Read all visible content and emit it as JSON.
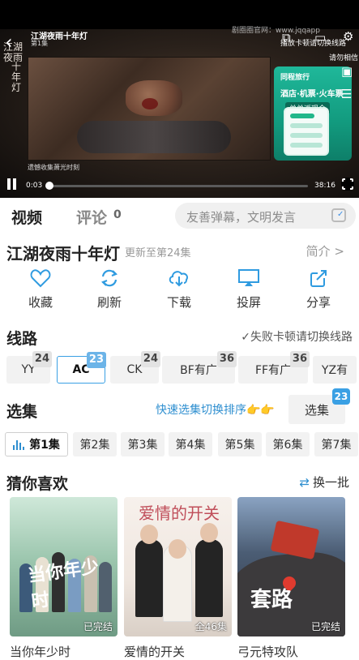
{
  "player": {
    "title": "江湖夜雨十年灯",
    "episode": "第1集",
    "watermark": "剧圈圈官网：www.jqqapp",
    "hint_line1": "播放卡顿请切换线路",
    "hint_line2": "请勿相信",
    "calligraphy_1": "江湖夜雨",
    "calligraphy_2": "十年灯",
    "subtitle": "遗憾收集萧光时刻",
    "current_time": "0:03",
    "total_time": "38:16",
    "progress_fraction": 0.01,
    "ad": {
      "brand": "同程旅行",
      "headline": "酒店·机票·火车票",
      "tag": "单单返现金"
    }
  },
  "tabs": {
    "video": "视频",
    "comments": "评论",
    "comments_count": "0"
  },
  "danmu": {
    "placeholder": "友善弹幕，文明发言"
  },
  "show": {
    "title": "江湖夜雨十年灯",
    "update": "更新至第24集",
    "intro_link": "简介 >"
  },
  "actions": [
    {
      "label": "收藏",
      "icon": "heart-icon"
    },
    {
      "label": "刷新",
      "icon": "refresh-icon"
    },
    {
      "label": "下载",
      "icon": "download-icon"
    },
    {
      "label": "投屏",
      "icon": "cast-icon"
    },
    {
      "label": "分享",
      "icon": "share-icon"
    }
  ],
  "routes_section": {
    "heading": "线路",
    "tip": "✓失败卡顿请切换线路",
    "items": [
      {
        "label": "YY",
        "count": "24",
        "active": false
      },
      {
        "label": "AC",
        "count": "23",
        "active": true
      },
      {
        "label": "CK",
        "count": "24",
        "active": false
      },
      {
        "label": "BF有广",
        "count": "36",
        "active": false
      },
      {
        "label": "FF有广",
        "count": "36",
        "active": false
      },
      {
        "label": "YZ有",
        "count": "",
        "active": false
      }
    ]
  },
  "episodes_section": {
    "heading": "选集",
    "quick_sort": "快速选集切换排序👉👉",
    "select_button": "选集",
    "select_badge": "23",
    "items": [
      "第1集",
      "第2集",
      "第3集",
      "第4集",
      "第5集",
      "第6集",
      "第7集"
    ],
    "active_index": 0
  },
  "recommend": {
    "heading": "猜你喜欢",
    "refresh": "换一批",
    "items": [
      {
        "name": "当你年少时",
        "status": "已完结",
        "poster_text": "当你年少时"
      },
      {
        "name": "爱情的开关",
        "status": "全46集",
        "poster_text": "爱情的开关"
      },
      {
        "name": "弓元特攻队",
        "status": "已完结",
        "poster_text": "套路"
      }
    ]
  },
  "colors": {
    "accent_blue": "#2f9be0",
    "active_badge": "#6cb4e8",
    "text_gray": "#999999"
  }
}
